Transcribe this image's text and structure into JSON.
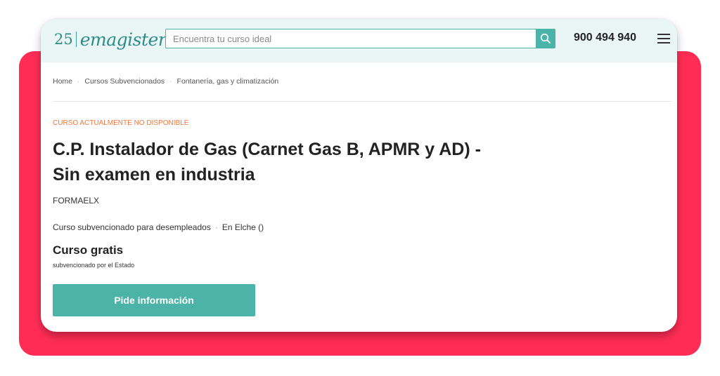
{
  "header": {
    "logo_number": "25",
    "logo_name": "emagister:",
    "search_placeholder": "Encuentra tu curso ideal",
    "search_icon": "search-icon",
    "phone": "900 494 940",
    "menu_icon": "hamburger-menu-icon"
  },
  "breadcrumb": [
    {
      "label": "Home"
    },
    {
      "label": "Cursos Subvencionados"
    },
    {
      "label": "Fontanería, gas y climatización"
    }
  ],
  "course": {
    "status": "CURSO ACTUALMENTE NO DISPONIBLE",
    "title": "C.P. Instalador de Gas (Carnet Gas B, APMR y AD) - Sin examen en industria",
    "provider": "FORMAELX",
    "modality": "Curso subvencionado para desempleados",
    "location": "En Elche ()",
    "price": "Curso gratis",
    "price_note": "subvencionado por el Estado",
    "cta_label": "Pide información"
  },
  "colors": {
    "accent": "#4bb3a8",
    "status": "#f0783f",
    "backdrop": "#ff2d55",
    "header_bg": "#eaf6f5"
  }
}
